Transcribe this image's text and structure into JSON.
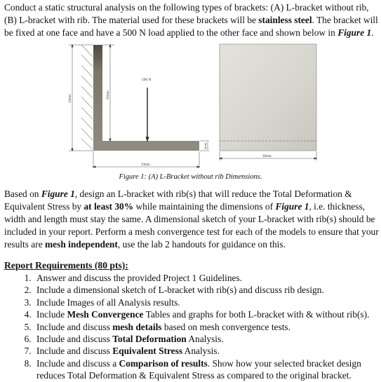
{
  "intro": {
    "t1": "Conduct a static structural analysis on the following types of brackets: (A) L-bracket without rib, (B) L-bracket with rib. The material used for these brackets will be ",
    "t1_bold": "stainless steel",
    "t2": ". The bracket will be fixed at one face and have a 500 N load applied to the other face and shown below in ",
    "t2_fig": "Figure 1",
    "t3": "."
  },
  "figure": {
    "load_label": "500 N",
    "dim_total_height": "33mm",
    "dim_inner_height": "30mm",
    "dim_thickness": "3mm",
    "dim_length": "33mm",
    "dim_width": "30mm",
    "colors": {
      "bracket": "#8f8b80",
      "bracket_top": "#4f4a40",
      "plate": "#dcdbd3"
    },
    "caption": "Figure 1: (A) L-Bracket without rib Dimensions."
  },
  "design": {
    "a1": "Based on ",
    "a_fig1": "Figure 1",
    "a2": ", design an L-bracket with rib(s) that will reduce the Total Deformation & Equivalent Stress by ",
    "a_bold": "at least 30%",
    "a3": " while maintaining the dimensions of ",
    "a_fig2": "Figure 1",
    "a4": ", i.e. thickness, width and length must stay the same. A dimensional sketch of your L-bracket with rib(s) should be included in your report. Perform a mesh convergence test for each of the models to ensure that your results are ",
    "a_bold2": "mesh independent",
    "a5": ", use the lab 2 handouts for guidance on this."
  },
  "requirements": {
    "title": "Report Requirements (80 pts):",
    "items": [
      {
        "pre": "Answer and discuss the provided Project 1 Guidelines.",
        "bold": "",
        "post": ""
      },
      {
        "pre": "Include a dimensional sketch of L-bracket with rib(s) and discuss rib design.",
        "bold": "",
        "post": ""
      },
      {
        "pre": "Include Images of all Analysis results.",
        "bold": "",
        "post": ""
      },
      {
        "pre": "Include ",
        "bold": "Mesh Convergence",
        "post": " Tables and graphs for both L-bracket with & without rib(s)."
      },
      {
        "pre": "Include and discuss ",
        "bold": "mesh details",
        "post": " based on mesh convergence tests."
      },
      {
        "pre": "Include and discuss ",
        "bold": "Total Deformation",
        "post": " Analysis."
      },
      {
        "pre": "Include and discuss ",
        "bold": "Equivalent Stress",
        "post": " Analysis."
      },
      {
        "pre": "Include and discuss a ",
        "bold": "Comparison of results",
        "post": ". Show how your selected bracket design reduces Total Deformation & Equivalent Stress as compared to the original bracket."
      }
    ]
  }
}
